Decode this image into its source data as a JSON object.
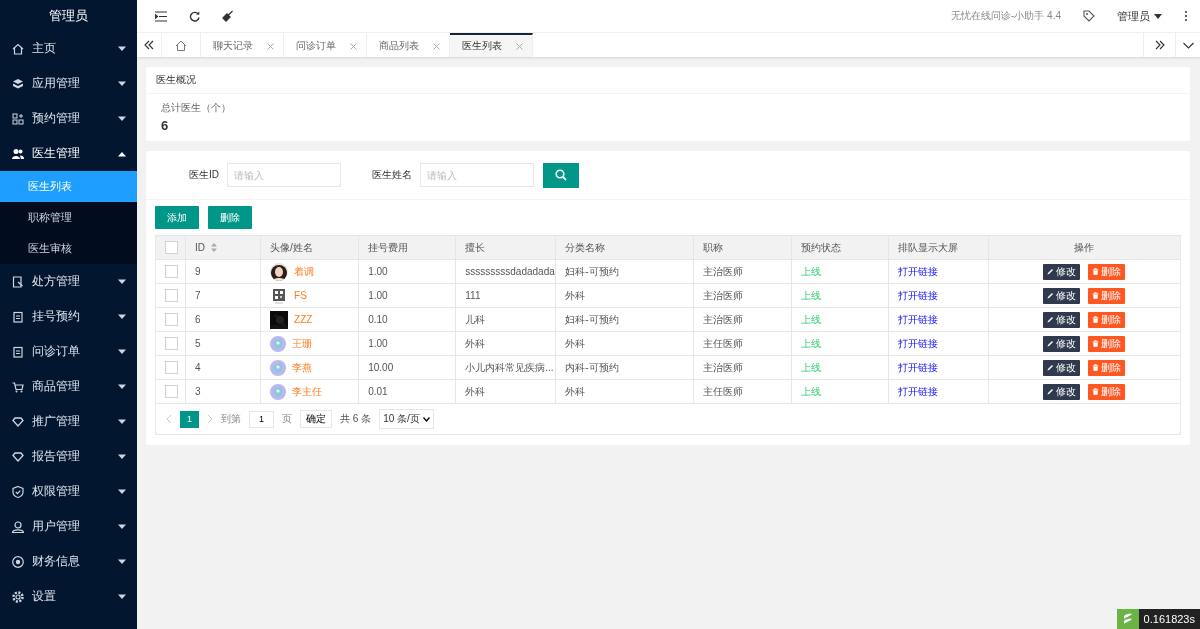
{
  "sidebar": {
    "title": "管理员",
    "items": [
      {
        "label": "主页",
        "expanded": false
      },
      {
        "label": "应用管理",
        "expanded": false
      },
      {
        "label": "预约管理",
        "expanded": false
      },
      {
        "label": "医生管理",
        "expanded": true,
        "children": [
          {
            "label": "医生列表",
            "selected": true
          },
          {
            "label": "职称管理",
            "selected": false
          },
          {
            "label": "医生审核",
            "selected": false
          }
        ]
      },
      {
        "label": "处方管理",
        "expanded": false
      },
      {
        "label": "挂号预约",
        "expanded": false
      },
      {
        "label": "问诊订单",
        "expanded": false
      },
      {
        "label": "商品管理",
        "expanded": false
      },
      {
        "label": "推广管理",
        "expanded": false
      },
      {
        "label": "报告管理",
        "expanded": false
      },
      {
        "label": "权限管理",
        "expanded": false
      },
      {
        "label": "用户管理",
        "expanded": false
      },
      {
        "label": "财务信息",
        "expanded": false
      },
      {
        "label": "设置",
        "expanded": false
      }
    ]
  },
  "header": {
    "version": "无忧在线问诊-小助手 4.4",
    "user": "管理员"
  },
  "tabs": [
    {
      "label": "聊天记录",
      "selected": false
    },
    {
      "label": "问诊订单",
      "selected": false
    },
    {
      "label": "商品列表",
      "selected": false
    },
    {
      "label": "医生列表",
      "selected": true
    }
  ],
  "overview": {
    "title": "医生概况",
    "stat_label": "总计医生（个）",
    "stat_value": "6"
  },
  "search": {
    "fields": [
      {
        "label": "医生ID",
        "placeholder": "请输入"
      },
      {
        "label": "医生姓名",
        "placeholder": "请输入"
      }
    ]
  },
  "toolbar": [
    "添加",
    "删除"
  ],
  "table": {
    "select_all": {
      "checked": false
    },
    "columns": [
      "ID",
      "头像/姓名",
      "挂号费用",
      "擅长",
      "分类名称",
      "职称",
      "预约状态",
      "排队显示大屏",
      "操作"
    ],
    "rows": [
      {
        "checked": false,
        "id": "9",
        "avatar": {
          "kind": "picture"
        },
        "name": "着调",
        "fee": "1.00",
        "specialty": "sssssssssdadadada",
        "category": "妇科-可预约",
        "title": "主治医师",
        "status": "上线",
        "queue": "打开链接",
        "actions": [
          "修改",
          "删除"
        ]
      },
      {
        "checked": false,
        "id": "7",
        "avatar": {
          "kind": "picture"
        },
        "name": "FS",
        "fee": "1.00",
        "specialty": "111",
        "category": "外科",
        "title": "主治医师",
        "status": "上线",
        "queue": "打开链接",
        "actions": [
          "修改",
          "删除"
        ]
      },
      {
        "checked": false,
        "id": "6",
        "avatar": {
          "kind": "picture"
        },
        "name": "ZZZ",
        "fee": "0.10",
        "specialty": "儿科",
        "category": "妇科-可预约",
        "title": "主治医师",
        "status": "上线",
        "queue": "打开链接",
        "actions": [
          "修改",
          "删除"
        ]
      },
      {
        "checked": false,
        "id": "5",
        "avatar": {
          "kind": "default"
        },
        "name": "王珊",
        "fee": "1.00",
        "specialty": "外科",
        "category": "外科",
        "title": "主任医师",
        "status": "上线",
        "queue": "打开链接",
        "actions": [
          "修改",
          "删除"
        ]
      },
      {
        "checked": false,
        "id": "4",
        "avatar": {
          "kind": "default"
        },
        "name": "李燕",
        "fee": "10.00",
        "specialty": "小儿内科常见疾病...",
        "category": "内科-可预约",
        "title": "主治医师",
        "status": "上线",
        "queue": "打开链接",
        "actions": [
          "修改",
          "删除"
        ]
      },
      {
        "checked": false,
        "id": "3",
        "avatar": {
          "kind": "default"
        },
        "name": "李主任",
        "fee": "0.01",
        "specialty": "外科",
        "category": "外科",
        "title": "主任医师",
        "status": "上线",
        "queue": "打开链接",
        "actions": [
          "修改",
          "删除"
        ]
      }
    ]
  },
  "pagination": {
    "pages": [
      {
        "label": "1",
        "selected": true
      }
    ],
    "goto_label": "到第",
    "goto_value": "1",
    "page_unit": "页",
    "confirm": "确定",
    "total": "共 6 条",
    "page_size": "10 条/页"
  },
  "timer": "0.161823s"
}
